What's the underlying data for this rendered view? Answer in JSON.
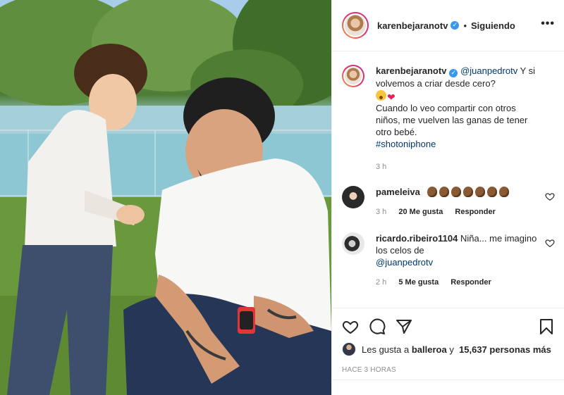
{
  "post": {
    "username": "karenbejaranotv",
    "follow_status": "Siguiendo",
    "more_icon": "more-dots-icon"
  },
  "caption": {
    "username": "karenbejaranotv",
    "mention": "@juanpedrotv",
    "text1": " Y si volvemos a criar desde cero?",
    "text2": "Cuando lo veo compartir con otros niños, me vuelven las ganas de tener otro bebé.",
    "hashtag": "#shotoniphone",
    "time": "3 h"
  },
  "comments": [
    {
      "username": "pameleiva",
      "text": "",
      "time": "3 h",
      "likes": "20 Me gusta",
      "reply": "Responder"
    },
    {
      "username": "ricardo.ribeiro1104",
      "text": " Niña... me imagino los celos de ",
      "mention": "@juanpedrotv",
      "time": "2 h",
      "likes": "5 Me gusta",
      "reply": "Responder"
    }
  ],
  "likes_line": {
    "prefix": "Les gusta a ",
    "user": "balleroa",
    "middle": " y ",
    "count": "15,637 personas más"
  },
  "timestamp": "HACE 3 HORAS",
  "colors": {
    "verified": "#3897f0",
    "link": "#00376b",
    "muted": "#8e8e8e"
  }
}
